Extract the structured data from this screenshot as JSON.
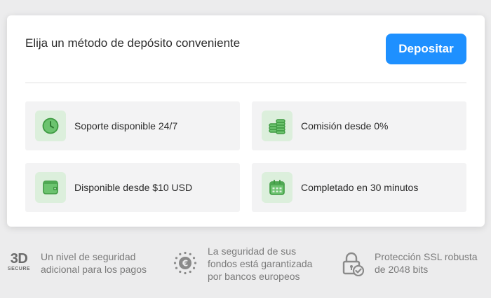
{
  "card": {
    "title": "Elija un método de depósito conveniente",
    "deposit_label": "Depositar"
  },
  "features": [
    {
      "label": "Soporte disponible 24/7",
      "icon": "clock-icon"
    },
    {
      "label": "Comisión desde 0%",
      "icon": "coins-icon"
    },
    {
      "label": "Disponible desde $10 USD",
      "icon": "wallet-icon"
    },
    {
      "label": "Completado en 30 minutos",
      "icon": "calendar-icon"
    }
  ],
  "trust": {
    "secure3d_big": "3D",
    "secure3d_small": "SECURE",
    "secure3d_text": "Un nivel de seguridad adicional para los pagos",
    "euro_text": "La seguridad de sus fondos está garantizada por bancos europeos",
    "ssl_text": "Protección SSL robusta de 2048 bits"
  },
  "colors": {
    "accent": "#1e90ff",
    "icon_green": "#4caf50",
    "icon_bg": "#dcefdc",
    "muted_text": "#7a7a7a"
  }
}
